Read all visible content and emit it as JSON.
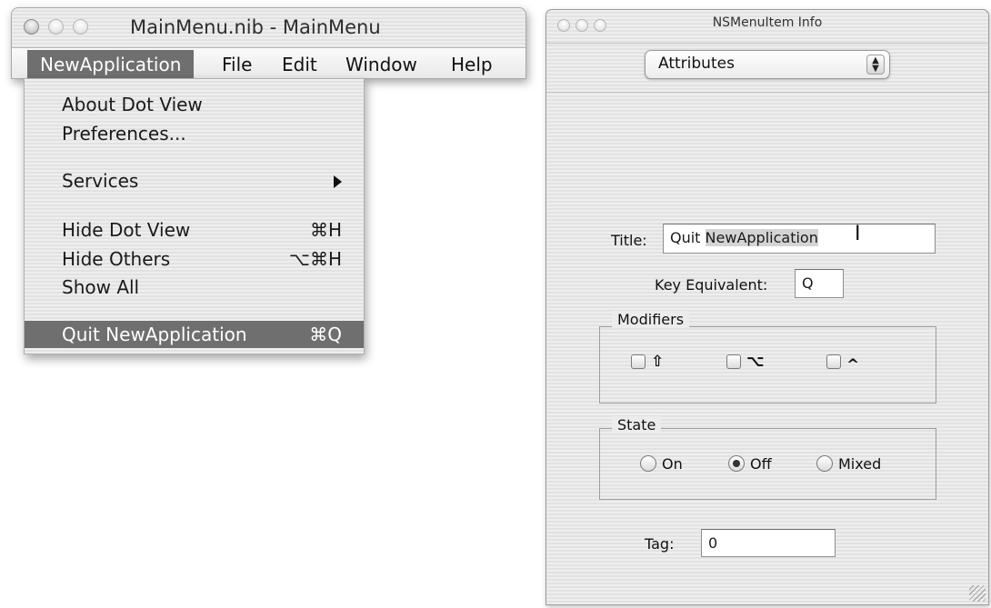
{
  "nib_window": {
    "title": "MainMenu.nib - MainMenu",
    "menubar": [
      {
        "label": "NewApplication",
        "selected": true
      },
      {
        "label": "File"
      },
      {
        "label": "Edit"
      },
      {
        "label": "Window"
      },
      {
        "label": "Help"
      }
    ]
  },
  "dropdown": {
    "items": [
      {
        "label": "About Dot View",
        "shortcut": ""
      },
      {
        "label": "Preferences...",
        "shortcut": ""
      },
      {
        "label": "Services",
        "shortcut": "",
        "submenu": true
      },
      {
        "label": "Hide Dot View",
        "shortcut": "⌘H"
      },
      {
        "label": "Hide Others",
        "shortcut": "⌥⌘H"
      },
      {
        "label": "Show All",
        "shortcut": ""
      },
      {
        "label": "Quit NewApplication",
        "shortcut": "⌘Q",
        "selected": true
      }
    ]
  },
  "info_window": {
    "title": "NSMenuItem Info",
    "popup_value": "Attributes",
    "title_label": "Title:",
    "title_value_plain": "Quit ",
    "title_value_selected": "NewApplication",
    "key_equiv_label": "Key Equivalent:",
    "key_equiv_value": "Q",
    "modifiers_title": "Modifiers",
    "modifiers": [
      {
        "symbol": "⇧",
        "checked": false
      },
      {
        "symbol": "⌥",
        "checked": false
      },
      {
        "symbol": "^",
        "checked": false
      }
    ],
    "state_title": "State",
    "states": [
      {
        "label": "On",
        "selected": false
      },
      {
        "label": "Off",
        "selected": true
      },
      {
        "label": "Mixed",
        "selected": false
      }
    ],
    "tag_label": "Tag:",
    "tag_value": "0"
  },
  "colors": {
    "selection": "#6f6f6f",
    "text_selection": "#d4d4d4"
  }
}
